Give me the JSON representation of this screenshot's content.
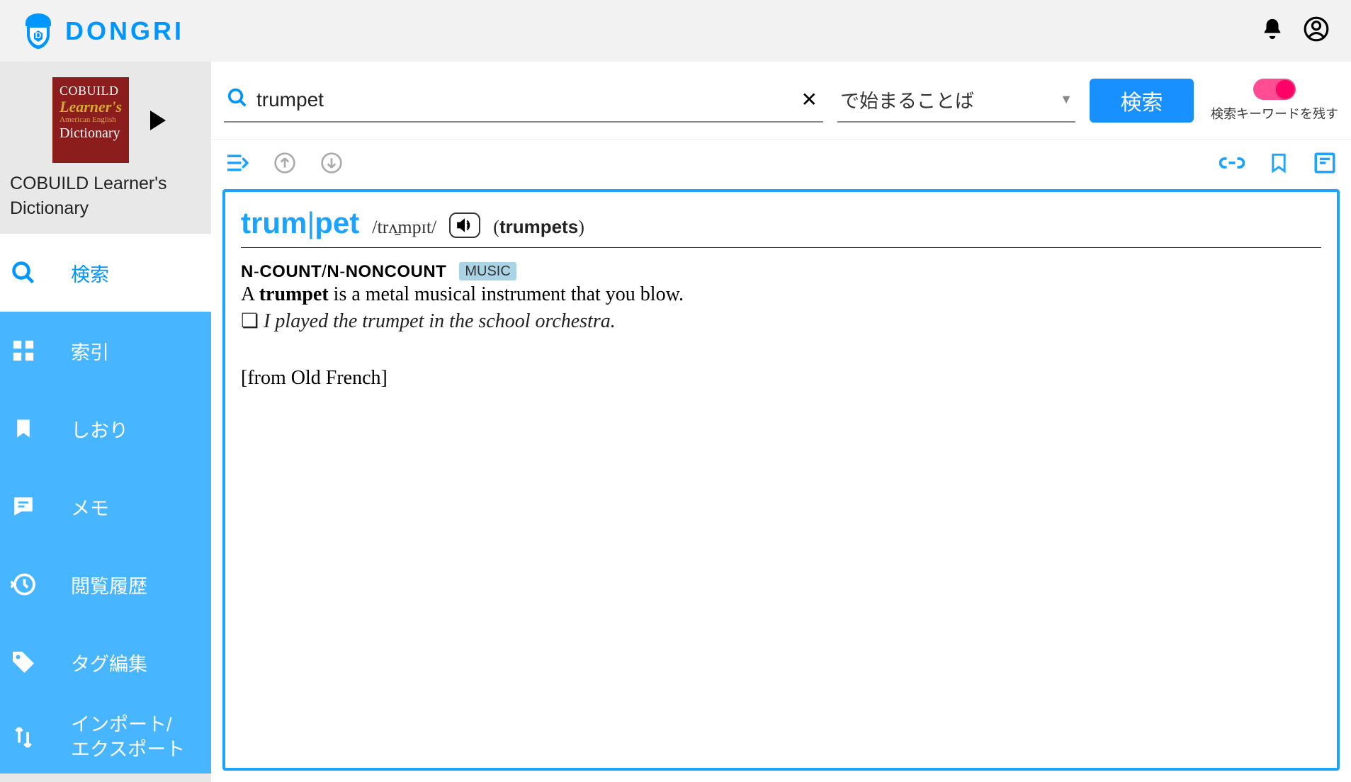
{
  "header": {
    "brand": "DONGRI"
  },
  "sidebar": {
    "dict_cover": {
      "line1": "COBUILD",
      "line2": "Learner's",
      "line3": "American English",
      "line4": "Dictionary"
    },
    "dict_name": "COBUILD Learner's Dictionary",
    "items": [
      {
        "label": "検索",
        "icon": "search"
      },
      {
        "label": "索引",
        "icon": "grid"
      },
      {
        "label": "しおり",
        "icon": "bookmark"
      },
      {
        "label": "メモ",
        "icon": "note"
      },
      {
        "label": "閲覧履歴",
        "icon": "history"
      },
      {
        "label": "タグ編集",
        "icon": "tag"
      },
      {
        "label": "インポート/\nエクスポート",
        "icon": "swap"
      }
    ]
  },
  "search": {
    "query": "trumpet",
    "mode": "で始まることば",
    "button": "検索",
    "toggle_label": "検索キーワードを残す",
    "toggle_on": true
  },
  "entry": {
    "headword_part1": "trum",
    "headword_part2": "pet",
    "pronunciation": "/trʌ̱mpɪt/",
    "forms": "trumpets",
    "pos": "N-COUNT/N-NONCOUNT",
    "domain": "MUSIC",
    "def_prefix": "A ",
    "def_bold": "trumpet",
    "def_rest": " is a metal musical instrument that you blow.",
    "example": "I played the trumpet in the school orchestra.",
    "etymology": "[from Old French]"
  }
}
